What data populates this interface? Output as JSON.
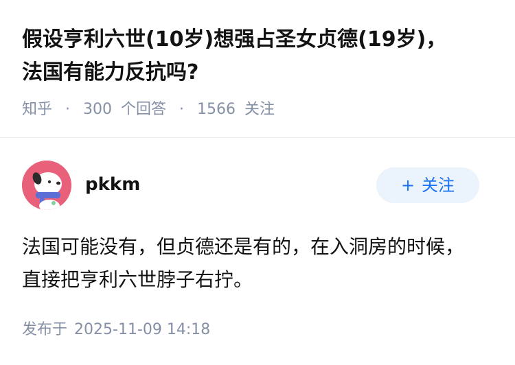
{
  "question": {
    "title": "假设亨利六世(10岁)想强占圣女贞德(19岁)，法国有能力反抗吗?",
    "source": "知乎",
    "separator": "·",
    "answer_count": "300",
    "answer_label": "个回答",
    "follower_count": "1566",
    "follower_label": "关注"
  },
  "answer": {
    "author_name": "pkkm",
    "follow_button_label": "关注",
    "follow_icon": "+",
    "content": "法国可能没有，但贞德还是有的，在入洞房的时候，直接把亨利六世脖子右拧。",
    "publish_label": "发布于",
    "publish_time": "2025-11-09 14:18"
  },
  "colors": {
    "title_text": "#121212",
    "meta_text": "#8590a6",
    "accent": "#1772f6",
    "follow_bg": "#ebf3fc",
    "avatar_bg": "#e8607a"
  },
  "icons": {
    "avatar": "dog-avatar-icon",
    "follow": "plus-icon"
  }
}
